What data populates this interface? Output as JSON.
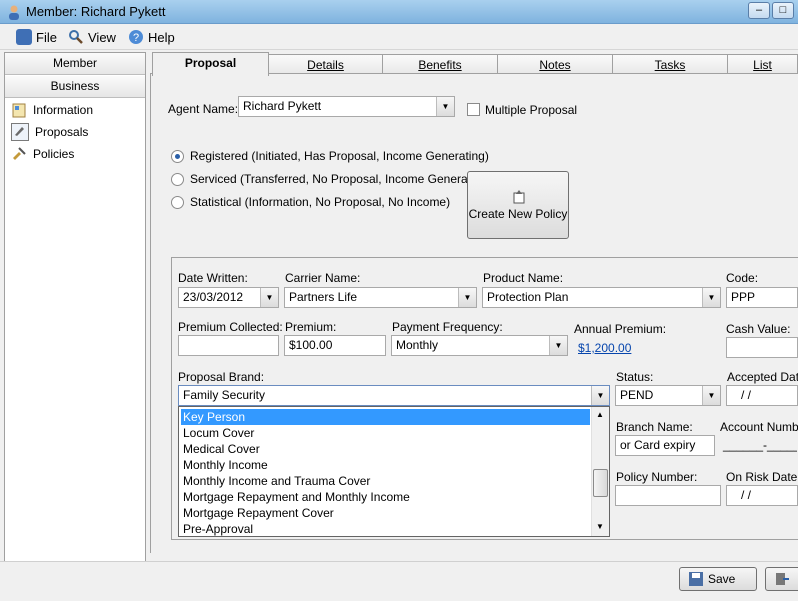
{
  "window": {
    "title": "Member: Richard Pykett"
  },
  "menu": {
    "file": "File",
    "view": "View",
    "help": "Help"
  },
  "nav": {
    "member": "Member",
    "business": "Business",
    "items": [
      {
        "label": "Information",
        "icon": "information-icon"
      },
      {
        "label": "Proposals",
        "icon": "proposals-icon"
      },
      {
        "label": "Policies",
        "icon": "policies-icon"
      }
    ]
  },
  "tabs": [
    "Proposal",
    "Details",
    "Benefits",
    "Notes",
    "Tasks",
    "List"
  ],
  "proposal": {
    "agent_label": "Agent Name:",
    "agent_value": "Richard Pykett",
    "multiple_label": "Multiple Proposal",
    "radios": [
      "Registered (Initiated, Has Proposal, Income Generating)",
      "Serviced (Transferred, No Proposal, Income Generating)",
      "Statistical (Information, No Proposal, No Income)"
    ],
    "create_button": "Create New Policy",
    "date_written_label": "Date Written:",
    "date_written": "23/03/2012",
    "carrier_label": "Carrier Name:",
    "carrier": "Partners Life",
    "product_label": "Product Name:",
    "product": "Protection Plan",
    "code_label": "Code:",
    "code": "PPP",
    "premium_collected_label": "Premium Collected:",
    "premium_collected": "",
    "premium_label": "Premium:",
    "premium": "$100.00",
    "payment_freq_label": "Payment Frequency:",
    "payment_freq": "Monthly",
    "annual_premium_label": "Annual Premium:",
    "annual_premium": "$1,200.00",
    "cash_value_label": "Cash Value:",
    "brand_label": "Proposal Brand:",
    "brand": "Family Security",
    "status_label": "Status:",
    "status": "PEND",
    "accepted_label": "Accepted Date",
    "accepted": "/   /",
    "branch_label": "Branch Name:",
    "branch": "or Card expiry",
    "account_label": "Account Number",
    "account": "______-______",
    "policy_number_label": "Policy Number:",
    "on_risk_label": "On Risk Date:",
    "on_risk": "/   /"
  },
  "dropdown": {
    "items": [
      "Key Person",
      "Locum Cover",
      "Medical Cover",
      "Monthly Income",
      "Monthly Income and Trauma Cover",
      "Mortgage Repayment and Monthly Income",
      "Mortgage Repayment Cover",
      "Pre-Approval"
    ],
    "selected": "Key Person"
  },
  "footer": {
    "save": "Save"
  }
}
